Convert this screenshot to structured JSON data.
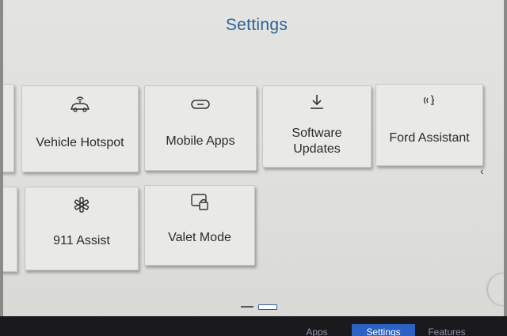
{
  "page": {
    "title": "Settings"
  },
  "tiles": [
    {
      "label": "Vehicle Hotspot",
      "icon": "vehicle-hotspot-icon"
    },
    {
      "label": "Mobile Apps",
      "icon": "link-icon"
    },
    {
      "label_line1": "Software",
      "label_line2": "Updates",
      "icon": "download-icon"
    },
    {
      "label": "Ford Assistant",
      "icon": "voice-assistant-icon"
    },
    {
      "label": "911 Assist",
      "icon": "emergency-asterisk-icon"
    },
    {
      "label": "Valet Mode",
      "icon": "valet-lock-icon"
    }
  ],
  "pagination": {
    "pages": 2,
    "active_page": 2
  },
  "bottom_nav": {
    "items": [
      "Apps",
      "Settings",
      "Features"
    ],
    "active": "Settings"
  },
  "nav_chevron": "‹",
  "colors": {
    "accent": "#2f5f9a",
    "nav_active": "#2b62c4",
    "tile": "#e9eae6"
  }
}
